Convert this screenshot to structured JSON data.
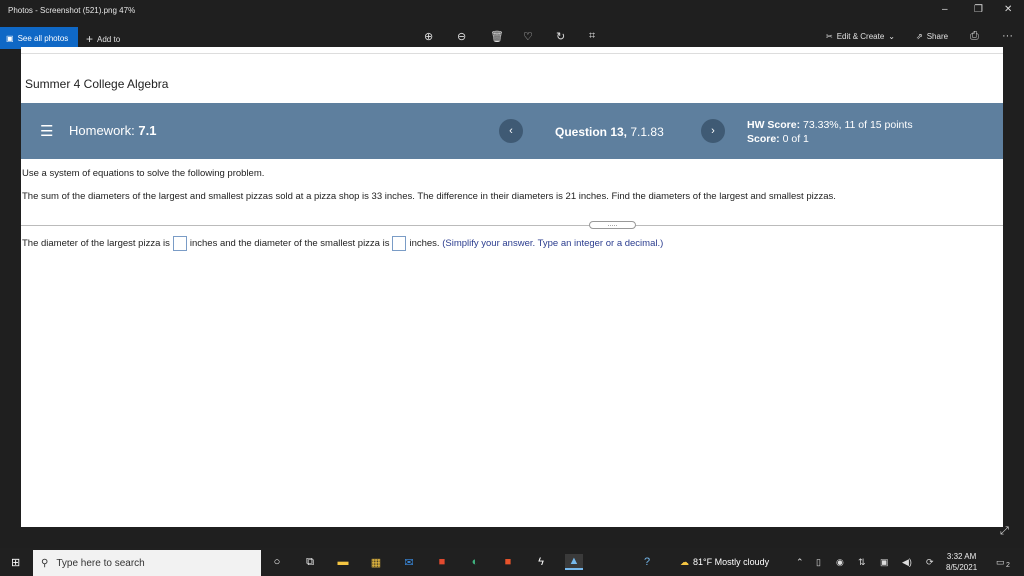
{
  "window": {
    "title": "Photos - Screenshot (521).png  47%",
    "minimize": "–",
    "restore": "❐",
    "close": "✕"
  },
  "toolbar": {
    "see_all_photos": "See all photos",
    "add_to": "Add to",
    "edit_create": "Edit & Create",
    "share": "Share",
    "more": "···"
  },
  "course": {
    "title": "Summer 4 College Algebra"
  },
  "homework": {
    "label": "Homework:",
    "number": "7.1",
    "question_label": "Question 13,",
    "question_code": "7.1.83",
    "hw_score_label": "HW Score:",
    "hw_score_value": "73.33%, 11 of 15 points",
    "score_label": "Score:",
    "score_value": "0 of 1"
  },
  "question": {
    "instruction": "Use a system of equations to solve the following problem.",
    "problem": "The sum of the diameters of the largest and smallest pizzas sold at a pizza shop is 33 inches. The difference in their diameters is 21 inches. Find the diameters of the largest and smallest pizzas.",
    "divider_dots": ".....",
    "answer_part1": "The diameter of the largest pizza is",
    "answer_part2": "inches and the diameter of the smallest pizza is",
    "answer_part3": "inches.",
    "answer_hint": "(Simplify your answer. Type an integer or a decimal.)",
    "largest_value": "",
    "smallest_value": ""
  },
  "taskbar": {
    "search_placeholder": "Type here to search",
    "weather": "81°F  Mostly cloudy",
    "time": "3:32 AM",
    "date": "8/5/2021",
    "notification_count": "2"
  },
  "colors": {
    "hw_bar": "#5e7f9e",
    "accent_blue": "#0f68c6",
    "hint_text": "#2b3d8f"
  }
}
